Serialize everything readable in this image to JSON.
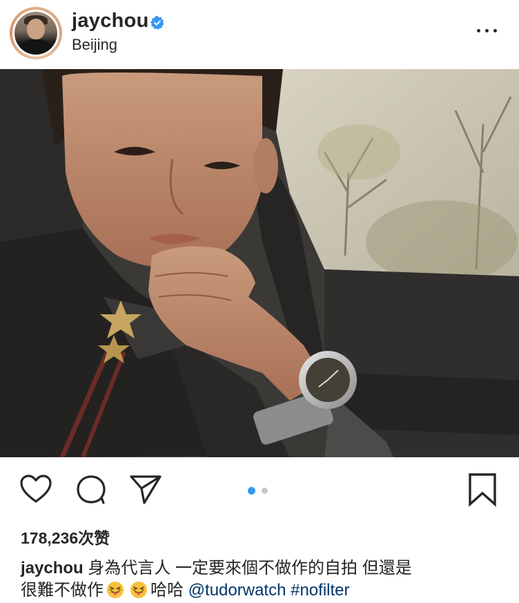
{
  "post": {
    "username": "jaychou",
    "location": "Beijing",
    "verified": true,
    "likes_text": "178,236次赞",
    "caption": {
      "username": "jaychou",
      "line1": "身為代言人 一定要來個不做作的自拍 但還是",
      "line2_prefix": "很難不做作",
      "emoji": [
        "squinting-face-with-tongue",
        "squinting-face-with-tongue"
      ],
      "line2_suffix": "哈哈",
      "mention": "@tudorwatch",
      "hashtag": "#nofilter"
    },
    "carousel": {
      "count": 2,
      "active_index": 0
    }
  },
  "icons": {
    "more": "more-options-icon",
    "like": "heart-icon",
    "comment": "comment-icon",
    "share": "paper-plane-icon",
    "save": "bookmark-icon",
    "verified": "verified-badge-icon"
  },
  "colors": {
    "text": "#262626",
    "verified": "#3897f0",
    "dot_active": "#3897f0",
    "dot_inactive": "#c7c7c7",
    "link": "#003569"
  }
}
